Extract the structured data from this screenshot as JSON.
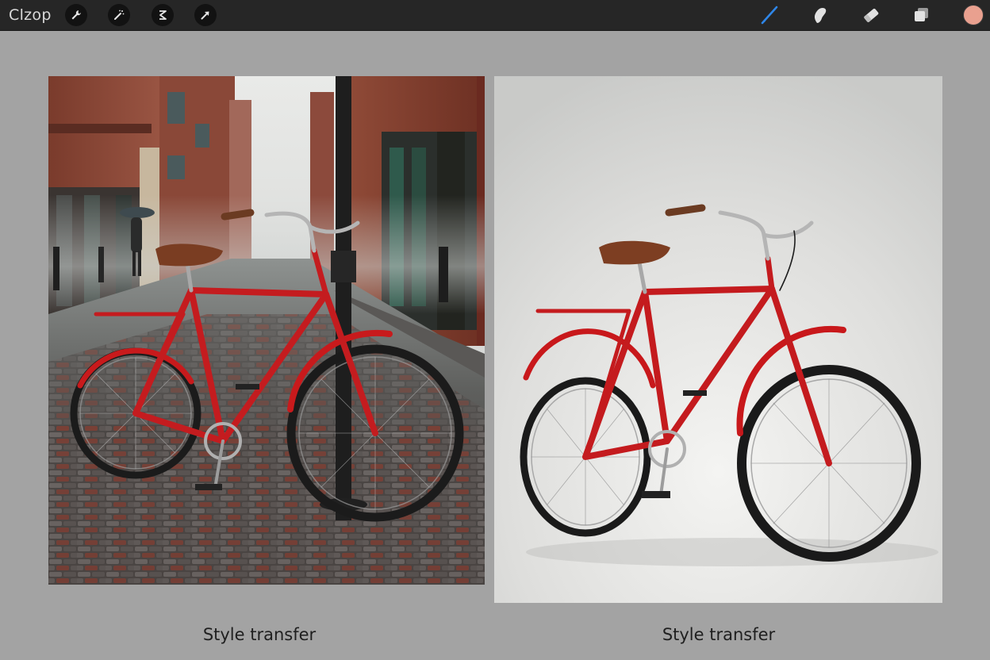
{
  "app": {
    "title": "Clzop"
  },
  "toolbar": {
    "left_tools": [
      {
        "icon": "wrench-icon"
      },
      {
        "icon": "magic-wand-icon"
      },
      {
        "icon": "selection-icon"
      },
      {
        "icon": "arrow-cursor-icon"
      }
    ],
    "right_tools": [
      {
        "icon": "brush-icon",
        "active": true
      },
      {
        "icon": "smudge-icon"
      },
      {
        "icon": "eraser-icon"
      },
      {
        "icon": "layers-icon"
      }
    ],
    "current_color": "#e9a08f",
    "accent_color": "#2f86e8"
  },
  "canvas": {
    "panels": [
      {
        "scene": "rainy-street-red-bicycle",
        "caption": "Style transfer"
      },
      {
        "scene": "studio-red-bicycle",
        "caption": "Style transfer"
      }
    ]
  }
}
